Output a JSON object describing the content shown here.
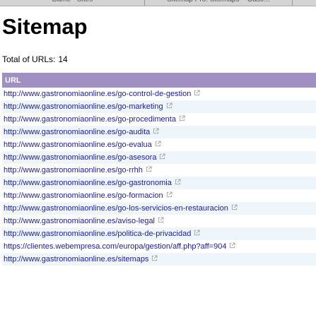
{
  "tabs": [
    {
      "label": "Game - Sites"
    },
    {
      "label": "Sitemap Pro: Sitemaps – Gastr..."
    },
    {
      "label": ""
    }
  ],
  "page": {
    "title": "Sitemap",
    "total_label": "Total of URLs:",
    "total_count": "14"
  },
  "table": {
    "header": "URL",
    "rows": [
      {
        "url": "http://www.gastronomiaonline.es/go-control-de-gestion"
      },
      {
        "url": "http://www.gastronomiaonline.es/go-marketing"
      },
      {
        "url": "http://www.gastronomiaonline.es/go-procedimenta"
      },
      {
        "url": "http://www.gastronomiaonline.es/go-audita"
      },
      {
        "url": "http://www.gastronomiaonline.es/go-evalua"
      },
      {
        "url": "http://www.gastronomiaonline.es/go-asesora"
      },
      {
        "url": "http://www.gastronomiaonline.es/go-rrhh"
      },
      {
        "url": "http://www.gastronomiaonline.es/go-gastronomia"
      },
      {
        "url": "http://www.gastronomiaonline.es/go-formacion"
      },
      {
        "url": "http://www.gastronomiaonline.es/go-los-servicios-en-restauracion"
      },
      {
        "url": "http://www.gastronomiaonline.es/aviso-legal"
      },
      {
        "url": "http://www.gastronomiaonline.es/politica-de-privacidad"
      },
      {
        "url": "https://clientes.webempresa.com/europa/gestion/aff.php?aff=904"
      },
      {
        "url": "http://www.gastronomiaonline.es/sitemaps"
      }
    ]
  },
  "icons": {
    "external_link": "external-link-icon"
  },
  "colors": {
    "header_bg": "#9f8fc2",
    "row_alt_bg": "#eef6fc",
    "link": "#1a1aa6"
  }
}
